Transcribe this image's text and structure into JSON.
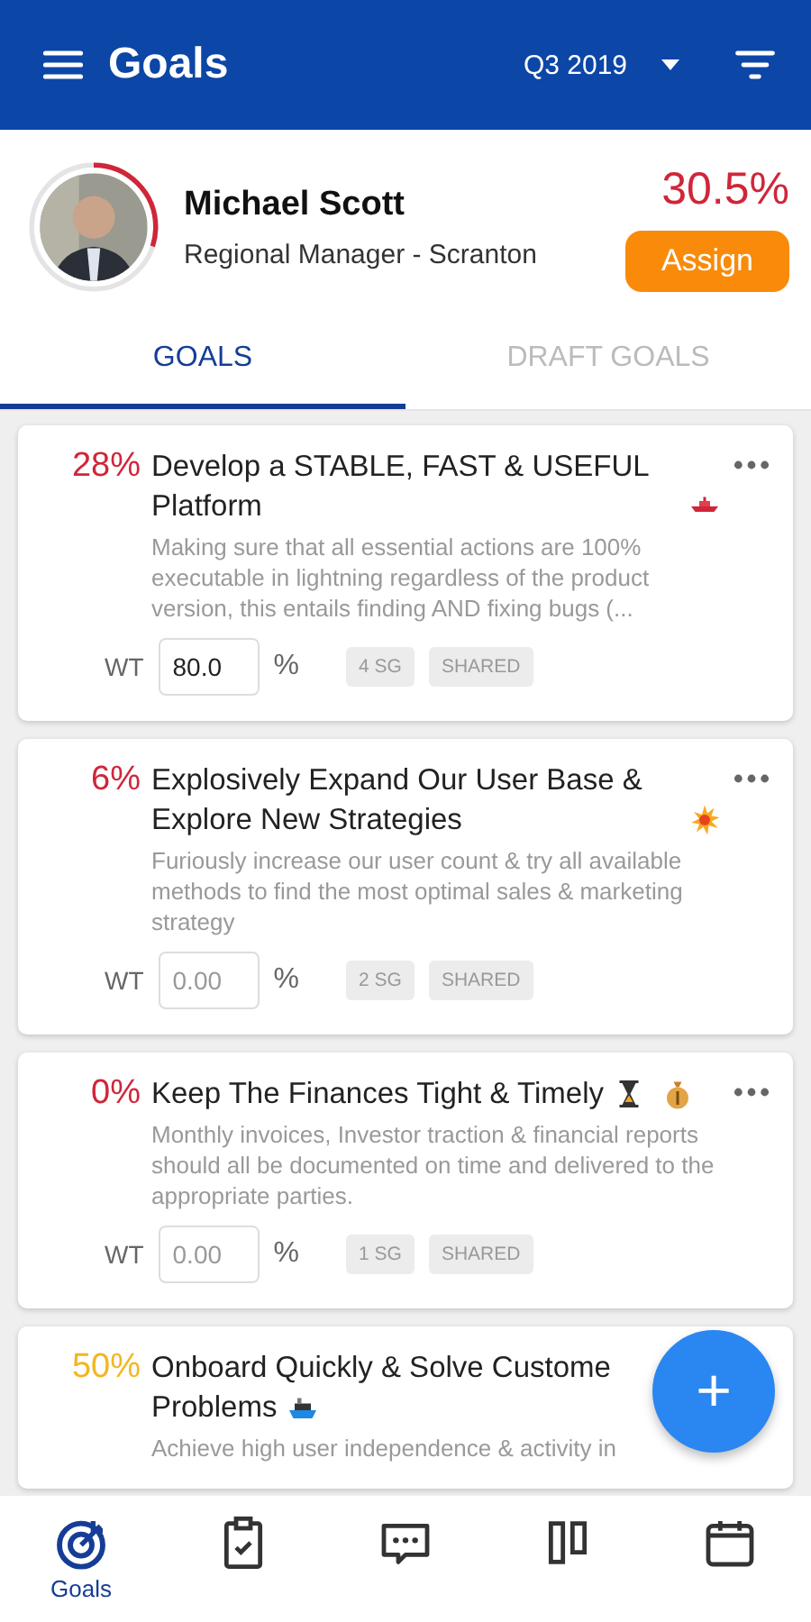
{
  "app_bar": {
    "title": "Goals",
    "period": "Q3 2019"
  },
  "profile": {
    "name": "Michael Scott",
    "role": "Regional Manager - Scranton",
    "score": "30.5%",
    "ring": {
      "level": 0.3
    },
    "action": "Assign"
  },
  "tabs": [
    {
      "label": "GOALS",
      "selected": true
    },
    {
      "label": "DRAFT GOALS",
      "selected": false
    }
  ],
  "goals": [
    {
      "percent": "28%",
      "color": "#d0263a",
      "title": "Develop a STABLE, FAST & USEFUL Platform",
      "emojis": [
        {
          "kind": "ship"
        }
      ],
      "description": "Making sure that all essential actions are 100% executable in lightning regardless of the product version, this entails finding AND fixing bugs (...",
      "weight_label": "WT",
      "weight": {
        "value": "80.0"
      },
      "unit": "%",
      "tags": [
        "4 SG",
        "SHARED"
      ]
    },
    {
      "percent": "6%",
      "color": "#d0263a",
      "title": "Explosively Expand Our User Base & Explore New Strategies",
      "emojis": [
        {
          "kind": "burst"
        }
      ],
      "description": "Furiously increase our user count & try all available methods to find the most optimal sales & marketing strategy",
      "weight_label": "WT",
      "weight": {
        "placeholder": "0.00"
      },
      "unit": "%",
      "tags": [
        "2 SG",
        "SHARED"
      ]
    },
    {
      "percent": "0%",
      "color": "#d0263a",
      "title": "Keep The Finances Tight & Timely",
      "emojis": [
        {
          "kind": "hourglass"
        },
        {
          "kind": "money-bag"
        }
      ],
      "description": "Monthly invoices, Investor traction & financial reports should all be documented on time and delivered to the appropriate parties.",
      "weight_label": "WT",
      "weight": {
        "placeholder": "0.00"
      },
      "unit": "%",
      "tags": [
        "1 SG",
        "SHARED"
      ]
    },
    {
      "percent": "50%",
      "color": "#f2b620",
      "title": "Onboard Quickly & Solve Custome",
      "title_line2": "Problems",
      "emojis": [
        {
          "kind": "ship-blue"
        }
      ],
      "description": "Achieve high user independence & activity in"
    }
  ],
  "fab": {
    "label": "+"
  },
  "bottom_nav": [
    {
      "kind": "target",
      "label": "Goals",
      "selected": true
    },
    {
      "kind": "clipboard",
      "selected": false
    },
    {
      "kind": "chat",
      "selected": false
    },
    {
      "kind": "columns",
      "selected": false
    },
    {
      "kind": "calendar",
      "selected": false
    }
  ]
}
